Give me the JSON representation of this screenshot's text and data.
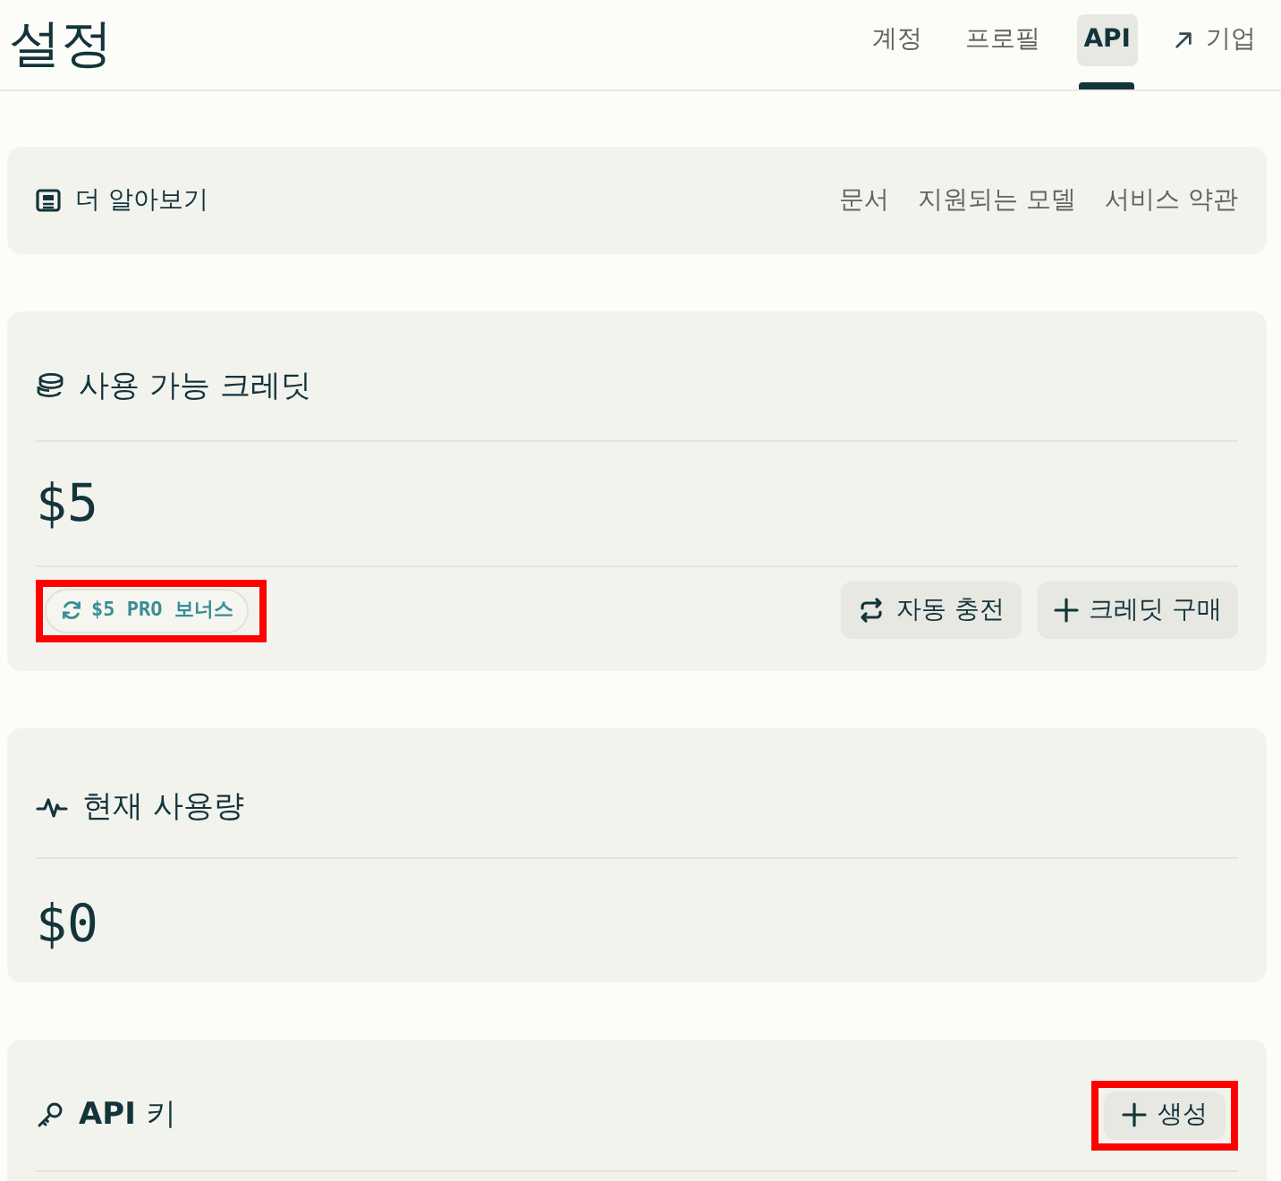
{
  "header": {
    "title": "설정"
  },
  "tabs": [
    {
      "label": "계정",
      "selected": false,
      "external": false
    },
    {
      "label": "프로필",
      "selected": false,
      "external": false
    },
    {
      "label": "API",
      "selected": true,
      "external": false
    },
    {
      "label": "기업",
      "selected": false,
      "external": true
    }
  ],
  "learn_more": {
    "title": "더 알아보기",
    "links": [
      "문서",
      "지원되는 모델",
      "서비스 약관"
    ]
  },
  "credits": {
    "title": "사용 가능 크레딧",
    "amount": "$5",
    "badge": {
      "label": "$5 PRO 보너스",
      "highlighted": true
    },
    "buttons": [
      {
        "kind": "auto_reload",
        "label": "자동 충전",
        "highlighted": false
      },
      {
        "kind": "purchase",
        "label": "크레딧 구매",
        "highlighted": false
      }
    ]
  },
  "usage": {
    "title": "현재 사용량",
    "amount": "$0"
  },
  "api_keys": {
    "title": "**API** 키",
    "button": {
      "kind": "create",
      "label": "생성",
      "highlighted": true
    }
  }
}
